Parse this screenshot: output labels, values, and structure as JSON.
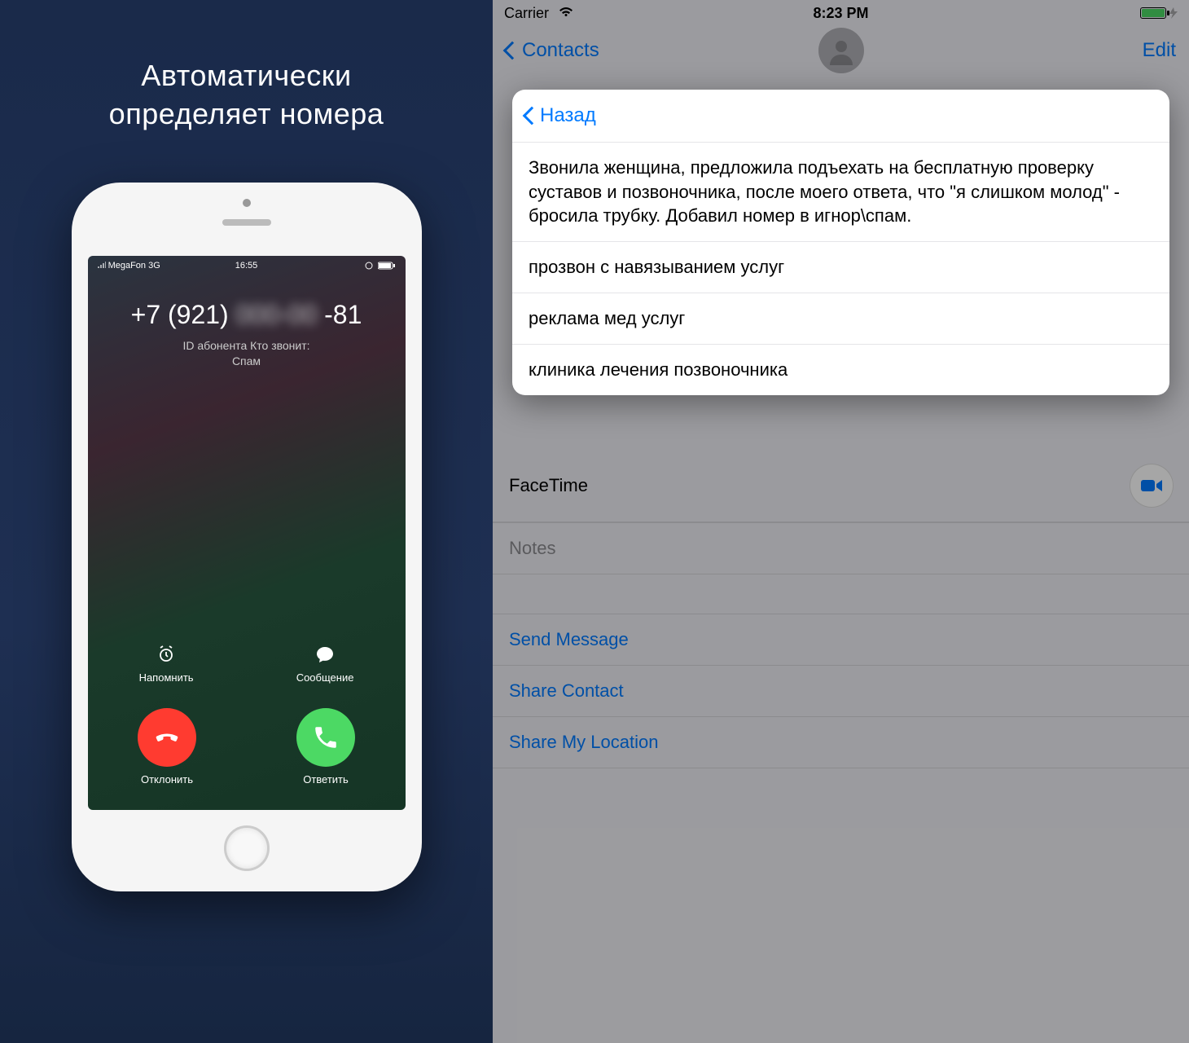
{
  "left": {
    "headline_l1": "Автоматически",
    "headline_l2": "определяет номера",
    "inner_status": {
      "carrier": "MegaFon",
      "net": "3G",
      "time": "16:55"
    },
    "call": {
      "prefix": "+7 (921)",
      "hidden": "000-00",
      "suffix": "-81",
      "sub_l1": "ID абонента Кто звонит:",
      "sub_l2": "Спам",
      "remind": "Напомнить",
      "message": "Сообщение",
      "decline": "Отклонить",
      "answer": "Ответить"
    }
  },
  "right": {
    "status": {
      "carrier": "Carrier",
      "time": "8:23 PM"
    },
    "nav": {
      "back": "Contacts",
      "edit": "Edit"
    },
    "popover": {
      "back": "Назад",
      "review": "Звонила женщина, предложила подъехать на бесплатную проверку суставов и позвоночника, после моего ответа, что \"я слишком молод\" - бросила трубку. Добавил номер в игнор\\спам.",
      "items": [
        "прозвон с навязыванием услуг",
        "реклама мед услуг",
        "клиника лечения позвоночника"
      ]
    },
    "rows": {
      "facetime": "FaceTime",
      "notes": "Notes",
      "send_message": "Send Message",
      "share_contact": "Share Contact",
      "share_location": "Share My Location"
    }
  }
}
